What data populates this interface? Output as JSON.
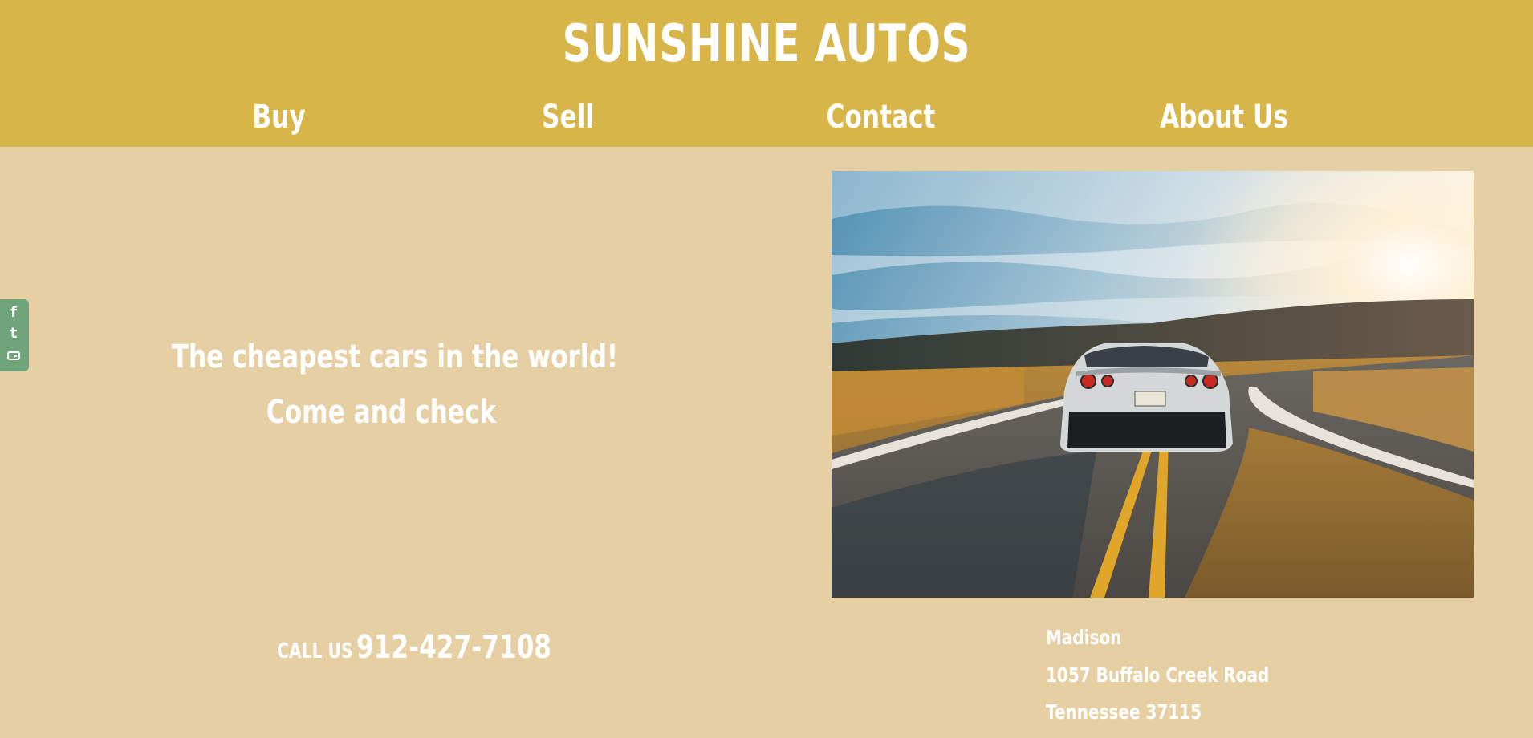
{
  "header": {
    "title": "SUNSHINE AUTOS",
    "nav": [
      {
        "label": "Buy"
      },
      {
        "label": "Sell"
      },
      {
        "label": "Contact"
      },
      {
        "label": "About Us"
      }
    ]
  },
  "social": {
    "icons": [
      {
        "name": "facebook-icon",
        "glyph": "f"
      },
      {
        "name": "tumblr-icon",
        "glyph": "t"
      },
      {
        "name": "youtube-icon",
        "glyph": ""
      }
    ]
  },
  "hero": {
    "tagline_line1": "The cheapest cars in the world!",
    "tagline_line2": "Come and check"
  },
  "contact": {
    "call_label": "CALL US",
    "phone": "912-427-7108",
    "address": [
      "Madison",
      "1057 Buffalo Creek Road",
      "Tennessee 37115"
    ]
  },
  "colors": {
    "header_bg": "#d7b548",
    "page_bg": "#e6cfa3",
    "social_bar": "#6fa37a",
    "text": "#ffffff"
  }
}
